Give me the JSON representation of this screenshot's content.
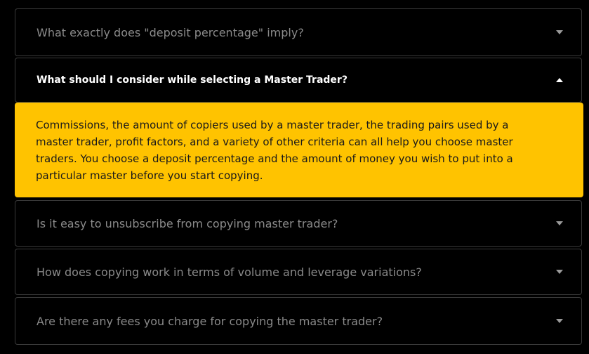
{
  "faq": {
    "items": [
      {
        "question": "What exactly does \"deposit percentage\" imply?",
        "expanded": false
      },
      {
        "question": "What should I consider while selecting a Master Trader?",
        "expanded": true,
        "answer": "Commissions, the amount of copiers used by a master trader, the trading pairs used by a master trader, profit factors, and a variety of other criteria can all help you choose master traders. You choose a deposit percentage and the amount of money you wish to put into a particular master before you start copying."
      },
      {
        "question": "Is it easy to unsubscribe from copying master trader?",
        "expanded": false
      },
      {
        "question": "How does copying work in terms of volume and leverage variations?",
        "expanded": false
      },
      {
        "question": "Are there any fees you charge for copying the master trader?",
        "expanded": false
      }
    ],
    "icons": {
      "collapsed": "caret-down-icon",
      "expanded": "caret-up-icon"
    },
    "colors": {
      "background": "#000000",
      "answer_bg": "#ffc300",
      "question_muted": "#8a8a8a",
      "question_active": "#ffffff",
      "border": "#3a3a3a"
    }
  }
}
